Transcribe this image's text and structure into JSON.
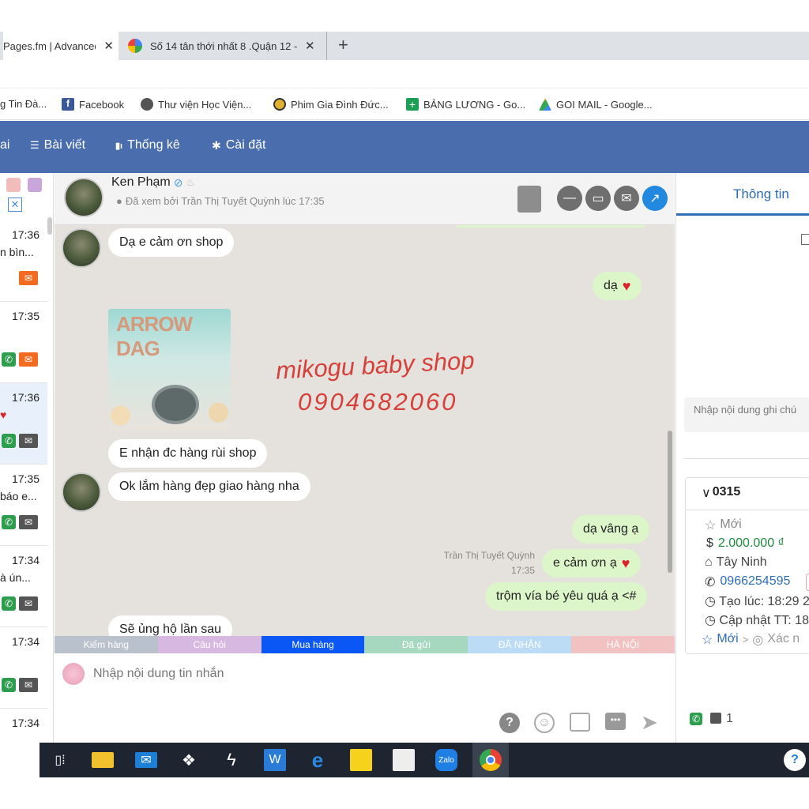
{
  "browser": {
    "tabs": [
      {
        "title": "Pages.fm | Advanced",
        "close": "✕"
      },
      {
        "title": "Số 14 tân thới nhất 8 .Quận 12 -",
        "close": "✕"
      }
    ],
    "new_tab": "+",
    "bookmarks": [
      {
        "label": "g Tin Đà...",
        "icon": "bookmark-icon"
      },
      {
        "label": "Facebook",
        "icon": "facebook-icon"
      },
      {
        "label": "Thư viện Học Viện...",
        "icon": "globe-icon"
      },
      {
        "label": "Phim Gia Đình Đức...",
        "icon": "film-icon"
      },
      {
        "label": "BẢNG LƯƠNG - Go...",
        "icon": "sheets-icon"
      },
      {
        "label": "GOI MAIL - Google...",
        "icon": "drive-icon"
      }
    ]
  },
  "nav": {
    "partial": "ai",
    "items": [
      {
        "label": "Bài viết",
        "icon": "list-icon"
      },
      {
        "label": "Thống kê",
        "icon": "chart-icon"
      },
      {
        "label": "Cài đặt",
        "icon": "gear-icon"
      }
    ]
  },
  "conversations": [
    {
      "time": "17:36",
      "snippet": "n bìn..."
    },
    {
      "time": "17:35",
      "snippet": ""
    },
    {
      "time": "17:36",
      "snippet": "♥"
    },
    {
      "time": "17:35",
      "snippet": "báo e..."
    },
    {
      "time": "17:34",
      "snippet": "à ún..."
    },
    {
      "time": "17:34",
      "snippet": ""
    },
    {
      "time": "17:34",
      "snippet": ""
    }
  ],
  "chat": {
    "name": "Ken Phạm",
    "seen": "Đã xem bởi Trần Thị Tuyết Quỳnh lúc 17:35",
    "messages": {
      "m1": "Dạ e cảm ơn shop",
      "m2": "dạ",
      "m3": "E nhận đc hàng rùi shop",
      "m4": "Ok lắm hàng đẹp giao hàng nha",
      "m5": "dạ vâng ạ",
      "m6_sender": "Trần Thị Tuyết Quỳnh",
      "m6_time": "17:35",
      "m6": "e cảm ơn ạ",
      "m7": "trộm vía bé yêu quá ạ <#",
      "m8": "Sẽ ủng hộ lần sau"
    },
    "watermark_line1": "mikogu baby shop",
    "watermark_line2": "0904682060",
    "photo_text": "ARROW DAG",
    "labels": [
      {
        "text": "Kiểm hàng",
        "color": "#b9c1cc"
      },
      {
        "text": "Câu hỏi",
        "color": "#d7b8e0"
      },
      {
        "text": "Mua hàng",
        "color": "#0b57f5"
      },
      {
        "text": "Đã gửi",
        "color": "#a5d8be"
      },
      {
        "text": "ĐÃ NHẬN",
        "color": "#bcdcf6"
      },
      {
        "text": "HÀ NỘI",
        "color": "#f2c2c2"
      }
    ],
    "input_placeholder": "Nhập nội dung tin nhắn"
  },
  "right": {
    "tab": "Thông tin",
    "note_placeholder": "Nhập nội dung ghi chú",
    "order": {
      "id": "0315",
      "status": "Mới",
      "amount": "2.000.000 ₫",
      "province": "Tây Ninh",
      "phone": "0966254595",
      "created": "Tạo lúc: 18:29 2",
      "updated": "Cập nhật TT: 18",
      "step_current": "Mới",
      "step_next": "Xác n"
    },
    "footer_count": "1"
  },
  "colors": {
    "nav": "#4a6dad",
    "chat_bg": "#e5e1dc",
    "bubble_me": "#dcf5c9",
    "accent": "#2f6db5"
  }
}
